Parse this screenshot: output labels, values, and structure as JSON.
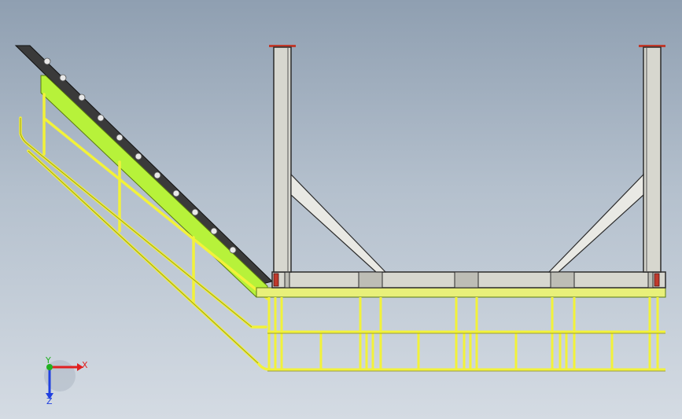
{
  "viewport": {
    "background_top": "#8f9fb1",
    "background_bottom": "#d4dbe3"
  },
  "model": {
    "steel_fill": "#d7d7cf",
    "steel_edge": "#2b2b2b",
    "handrail_color": "#f2f23a",
    "handrail_edge": "#8a8a10",
    "stringer_color": "#b7f23a",
    "flange_color": "#c0392b",
    "tread_color": "#3a3a3a"
  },
  "triad": {
    "x_label": "X",
    "y_label": "Y",
    "z_label": "Z",
    "x_color": "#e02020",
    "y_color": "#20b020",
    "z_color": "#2040e0"
  }
}
